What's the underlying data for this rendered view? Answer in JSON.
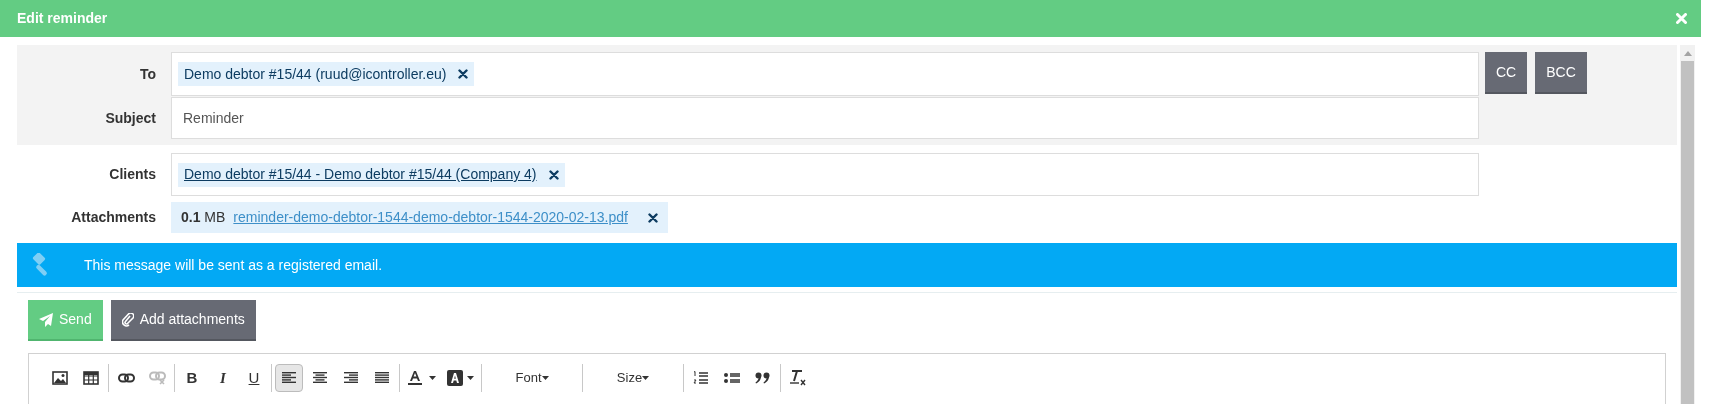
{
  "dialog": {
    "title": "Edit reminder"
  },
  "to": {
    "label": "To",
    "recipients": [
      {
        "text": "Demo debtor #15/44 (ruud@icontroller.eu)"
      }
    ]
  },
  "copy_buttons": [
    "CC",
    "BCC"
  ],
  "subject": {
    "label": "Subject",
    "value": "Reminder"
  },
  "clients": {
    "label": "Clients",
    "items": [
      {
        "text": "Demo debtor #15/44 - Demo debtor #15/44 (Company 4)"
      }
    ]
  },
  "attachments": {
    "label": "Attachments",
    "files": [
      {
        "size": "0.1",
        "unit": "MB",
        "name": "reminder-demo-debtor-1544-demo-debtor-1544-2020-02-13.pdf"
      }
    ]
  },
  "banner": {
    "text": "This message will be sent as a registered email."
  },
  "actions": {
    "send": "Send",
    "add_attachments": "Add attachments"
  },
  "toolbar": [
    [
      {
        "kind": "image",
        "disabled": false,
        "selected": false
      },
      {
        "kind": "table",
        "disabled": false,
        "selected": false
      }
    ],
    [
      {
        "kind": "link",
        "disabled": false,
        "selected": false
      },
      {
        "kind": "unlink",
        "disabled": true,
        "selected": false
      }
    ],
    [
      {
        "kind": "bold",
        "label": "B",
        "disabled": false,
        "selected": false
      },
      {
        "kind": "italic",
        "label": "I",
        "disabled": false,
        "selected": false
      },
      {
        "kind": "underline",
        "label": "U",
        "disabled": false,
        "selected": false
      }
    ],
    [
      {
        "kind": "align-left",
        "disabled": false,
        "selected": true
      },
      {
        "kind": "align-center",
        "disabled": false,
        "selected": false
      },
      {
        "kind": "align-right",
        "disabled": false,
        "selected": false
      },
      {
        "kind": "justify",
        "disabled": false,
        "selected": false
      }
    ],
    [
      {
        "kind": "text-color",
        "disabled": false,
        "selected": false
      },
      {
        "kind": "background-color",
        "disabled": false,
        "selected": false
      }
    ],
    [
      {
        "kind": "dropdown",
        "label": "Font",
        "disabled": false,
        "selected": false
      }
    ],
    [
      {
        "kind": "dropdown",
        "label": "Size",
        "disabled": false,
        "selected": false
      }
    ],
    [
      {
        "kind": "numbered-list",
        "disabled": false,
        "selected": false
      },
      {
        "kind": "bulleted-list",
        "disabled": false,
        "selected": false
      },
      {
        "kind": "blockquote",
        "disabled": false,
        "selected": false
      }
    ],
    [
      {
        "kind": "remove-format",
        "disabled": false,
        "selected": false
      }
    ]
  ]
}
